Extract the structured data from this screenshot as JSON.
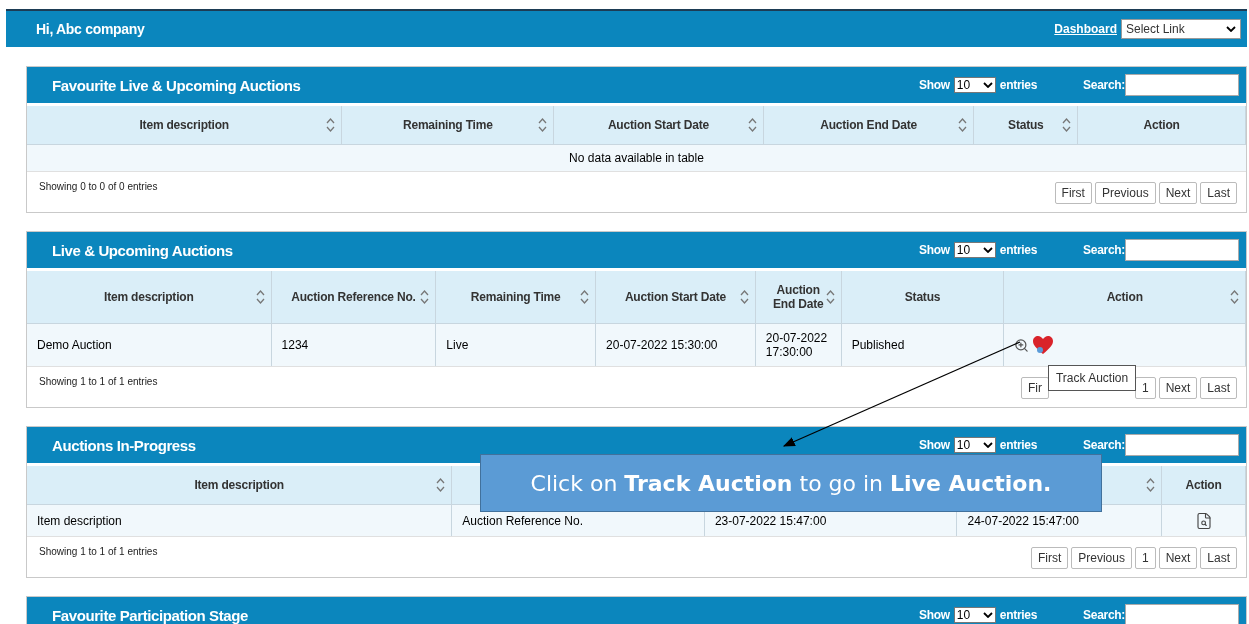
{
  "header": {
    "greeting": "Hi, Abc company",
    "link": "Dashboard",
    "select": "Select Link"
  },
  "panels": [
    {
      "title": "Favourite Live & Upcoming Auctions",
      "show_label": "Show",
      "show_value": "10",
      "entries_label": "entries",
      "search_label": "Search:",
      "columns": [
        {
          "label": "Item description",
          "sortable": true
        },
        {
          "label": "Remaining Time",
          "sortable": true
        },
        {
          "label": "Auction Start Date",
          "sortable": true
        },
        {
          "label": "Auction End Date",
          "sortable": true
        },
        {
          "label": "Status",
          "sortable": true
        },
        {
          "label": "Action",
          "sortable": false
        }
      ],
      "empty_message": "No data available in table",
      "info": "Showing 0 to 0 of 0 entries",
      "pager": [
        {
          "kind": "button",
          "label": "First"
        },
        {
          "kind": "button",
          "label": "Previous"
        },
        {
          "kind": "button",
          "label": "Next"
        },
        {
          "kind": "button",
          "label": "Last"
        }
      ]
    },
    {
      "title": "Live & Upcoming Auctions",
      "show_label": "Show",
      "show_value": "10",
      "entries_label": "entries",
      "search_label": "Search:",
      "columns": [
        {
          "label": "Item description",
          "sortable": true
        },
        {
          "label": "Auction Reference No.",
          "sortable": true
        },
        {
          "label": "Remaining Time",
          "sortable": true
        },
        {
          "label": "Auction Start Date",
          "sortable": true
        },
        {
          "label": "Auction End Date",
          "sortable": true
        },
        {
          "label": "Status",
          "sortable": false
        },
        {
          "label": "Action",
          "sortable": true
        }
      ],
      "rows": [
        {
          "cells": [
            "Demo Auction",
            "1234",
            "Live",
            "20-07-2022 15:30:00",
            "20-07-2022 17:30:00",
            "Published"
          ],
          "actions": [
            {
              "kind": "zoom"
            },
            {
              "kind": "heart"
            }
          ]
        }
      ],
      "info": "Showing 1 to 1 of 1 entries",
      "pager": [
        {
          "kind": "button",
          "label": "Fir"
        },
        {
          "kind": "covered"
        },
        {
          "kind": "button",
          "label": "1"
        },
        {
          "kind": "button",
          "label": "Next"
        },
        {
          "kind": "button",
          "label": "Last"
        }
      ],
      "tooltip": "Track Auction"
    },
    {
      "title": "Auctions In-Progress",
      "show_label": "Show",
      "show_value": "10",
      "entries_label": "entries",
      "search_label": "Search:",
      "columns": [
        {
          "label": "Item description",
          "sortable": true
        },
        {},
        {},
        {
          "sortable": true
        },
        {
          "label": "Action",
          "sortable": false
        }
      ],
      "rows": [
        {
          "cells": [
            "Item description",
            "Auction Reference No.",
            "23-07-2022 15:47:00",
            "24-07-2022 15:47:00"
          ],
          "actions": [
            {
              "kind": "document"
            }
          ]
        }
      ],
      "info": "Showing 1 to 1 of 1 entries",
      "pager": [
        {
          "kind": "button",
          "label": "First"
        },
        {
          "kind": "button",
          "label": "Previous"
        },
        {
          "kind": "button",
          "label": "1"
        },
        {
          "kind": "button",
          "label": "Next"
        },
        {
          "kind": "button",
          "label": "Last"
        }
      ]
    },
    {
      "title": "Favourite Participation Stage",
      "show_label": "Show",
      "show_value": "10",
      "entries_label": "entries",
      "search_label": "Search:"
    }
  ],
  "callout": "Click on **Track Auction** to go in **Live Auction.**"
}
